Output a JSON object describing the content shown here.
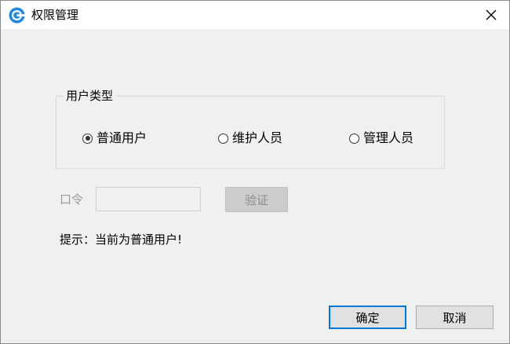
{
  "window": {
    "title": "权限管理"
  },
  "user_type_group": {
    "title": "用户类型",
    "options": [
      {
        "label": "普通用户",
        "checked": true
      },
      {
        "label": "维护人员",
        "checked": false
      },
      {
        "label": "管理人员",
        "checked": false
      }
    ]
  },
  "password": {
    "label": "口令",
    "value": "",
    "verify_label": "验证"
  },
  "hint": "提示：当前为普通用户!",
  "buttons": {
    "ok_label": "确定",
    "cancel_label": "取消"
  },
  "colors": {
    "accent": "#0078d7",
    "window_bg": "#f0f0f0",
    "disabled_text": "#9a9a9a"
  }
}
